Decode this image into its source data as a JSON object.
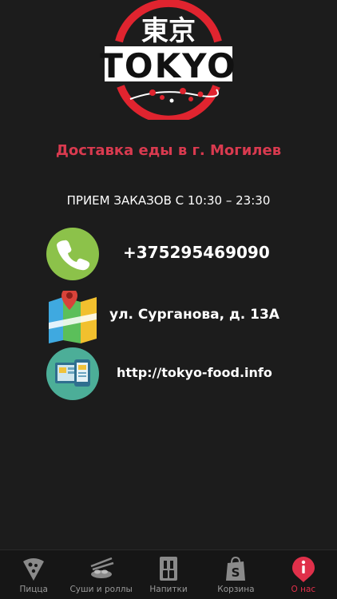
{
  "logo": {
    "kanji": "東京",
    "wordmark": "TOKYO",
    "ring_color": "#e0242f"
  },
  "tagline": "Доставка еды в г. Могилев",
  "hours": "ПРИЕМ ЗАКАЗОВ С 10:30 – 23:30",
  "contacts": {
    "phone": {
      "icon": "phone-icon",
      "text": "+375295469090"
    },
    "address": {
      "icon": "map-icon",
      "text": "ул. Сурганова, д. 13А"
    },
    "website": {
      "icon": "website-icon",
      "text": "http://tokyo-food.info"
    }
  },
  "tabbar": {
    "active_color": "#e0304a",
    "items": [
      {
        "icon": "pizza-icon",
        "label": "Пицца"
      },
      {
        "icon": "sushi-icon",
        "label": "Суши и роллы"
      },
      {
        "icon": "bottles-icon",
        "label": "Напитки"
      },
      {
        "icon": "shopping-bag-icon",
        "label": "Корзина"
      },
      {
        "icon": "info-icon",
        "label": "О нас",
        "active": true
      }
    ]
  }
}
